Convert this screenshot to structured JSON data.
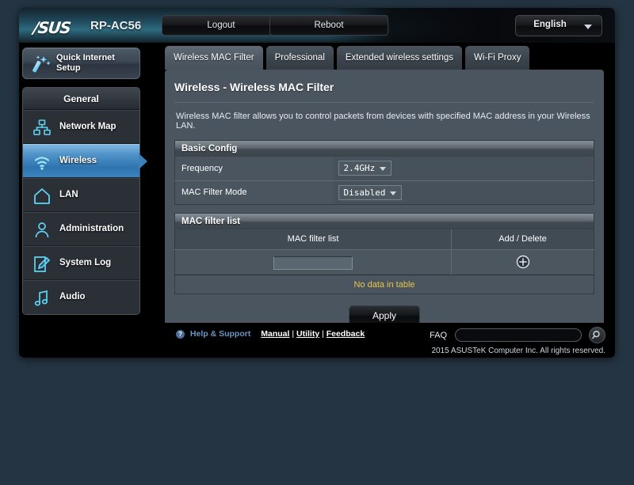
{
  "header": {
    "logo": "/SUS",
    "model": "RP-AC56",
    "logout_label": "Logout",
    "reboot_label": "Reboot",
    "language": "English",
    "language_icon": "chevron-down-icon"
  },
  "sidebar": {
    "quick_setup": {
      "label": "Quick Internet Setup",
      "icon": "magic-wand-icon"
    },
    "group_header": "General",
    "items": [
      {
        "label": "Network Map",
        "icon": "network-map-icon",
        "active": false
      },
      {
        "label": "Wireless",
        "icon": "wifi-icon",
        "active": true
      },
      {
        "label": "LAN",
        "icon": "home-icon",
        "active": false
      },
      {
        "label": "Administration",
        "icon": "user-icon",
        "active": false
      },
      {
        "label": "System Log",
        "icon": "pencil-document-icon",
        "active": false
      },
      {
        "label": "Audio",
        "icon": "music-note-icon",
        "active": false
      }
    ]
  },
  "tabs": [
    {
      "label": "Wireless MAC Filter",
      "active": true
    },
    {
      "label": "Professional",
      "active": false
    },
    {
      "label": "Extended wireless settings",
      "active": false
    },
    {
      "label": "Wi-Fi Proxy",
      "active": false
    }
  ],
  "main": {
    "title": "Wireless - Wireless MAC Filter",
    "description": "Wireless MAC filter allows you to control packets from devices with specified MAC address in your Wireless LAN.",
    "basic_config": {
      "section_title": "Basic Config",
      "rows": [
        {
          "label": "Frequency",
          "value": "2.4GHz"
        },
        {
          "label": "MAC Filter Mode",
          "value": "Disabled"
        }
      ]
    },
    "mac_filter": {
      "section_title": "MAC filter list",
      "columns": [
        "MAC filter list",
        "Add / Delete"
      ],
      "input_value": "",
      "add_icon": "plus-circle-icon",
      "empty_message": "No data in table"
    },
    "apply_label": "Apply"
  },
  "footer": {
    "help_icon": "question-mark-icon",
    "help_label": "Help & Support",
    "links": [
      "Manual",
      "Utility",
      "Feedback"
    ],
    "link_separator": "|",
    "faq_label": "FAQ",
    "faq_value": "",
    "faq_placeholder": "",
    "search_icon": "search-icon",
    "copyright": "2015 ASUSTeK Computer Inc. All rights reserved."
  },
  "colors": {
    "accent_blue": "#3b82bb",
    "panel": "#4a555f",
    "warning_yellow": "#e8c547",
    "link_blue": "#6c94c4"
  }
}
